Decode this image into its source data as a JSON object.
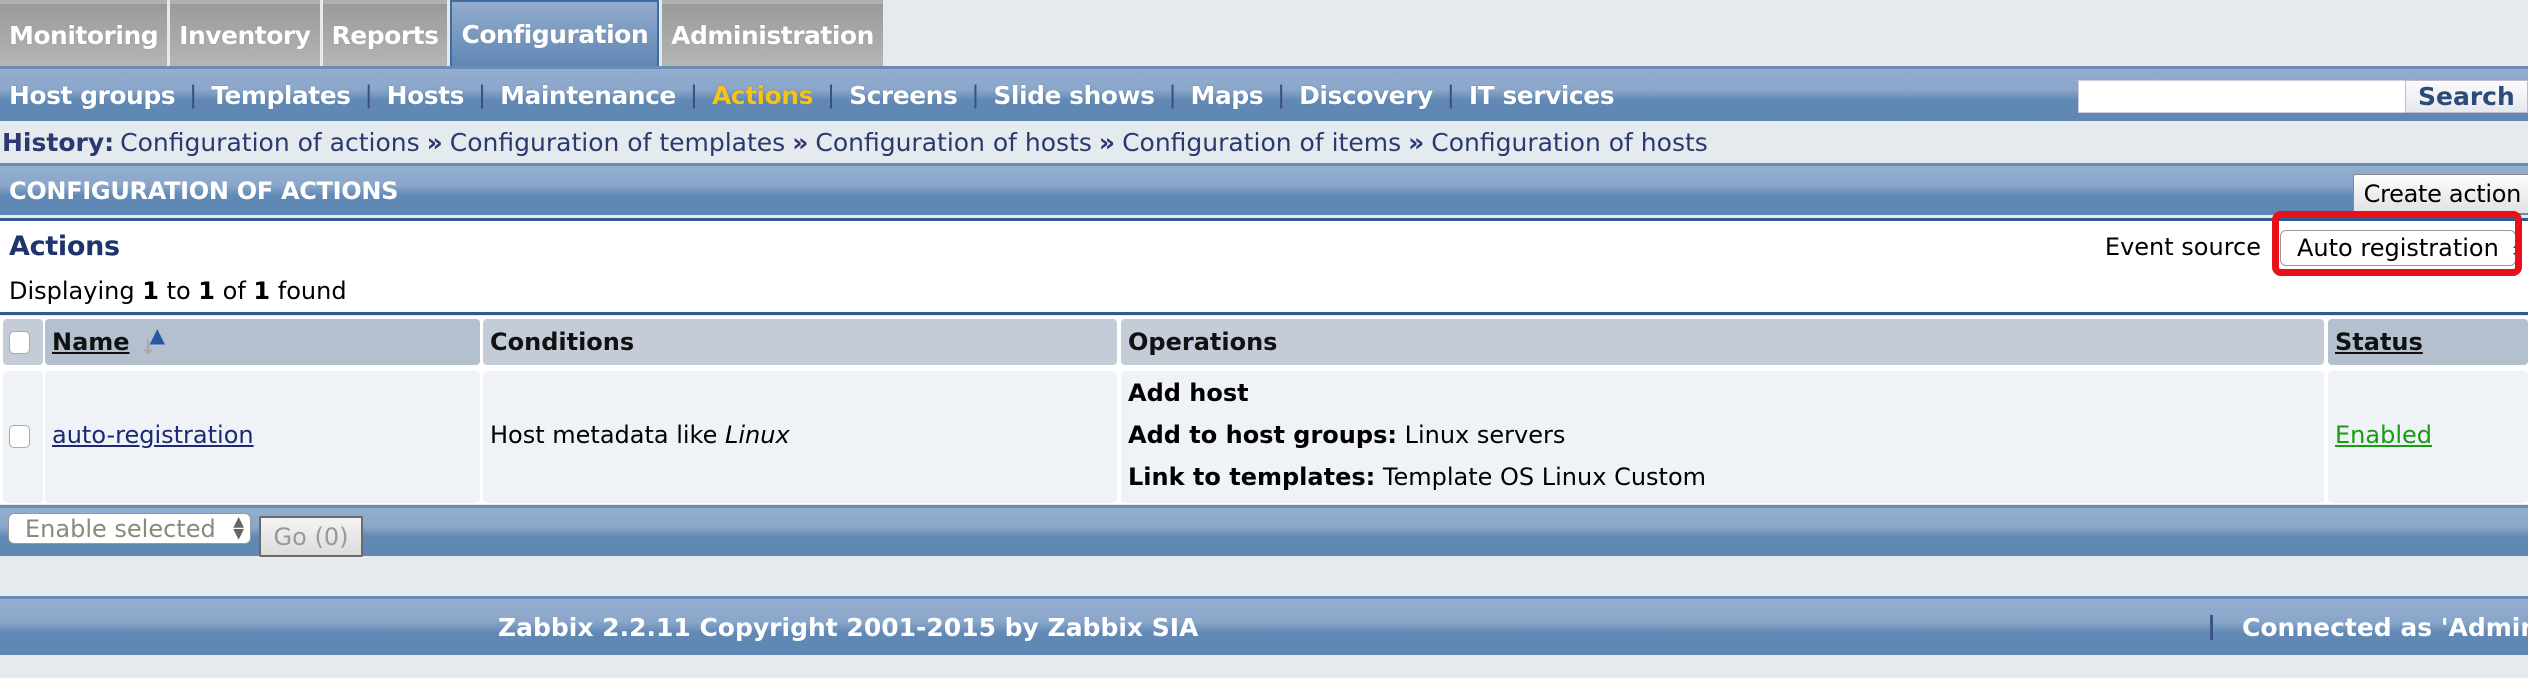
{
  "top_tabs": [
    {
      "label": "Monitoring",
      "active": false
    },
    {
      "label": "Inventory",
      "active": false
    },
    {
      "label": "Reports",
      "active": false
    },
    {
      "label": "Configuration",
      "active": true
    },
    {
      "label": "Administration",
      "active": false
    }
  ],
  "sub_nav": {
    "items": [
      {
        "label": "Host groups",
        "active": false
      },
      {
        "label": "Templates",
        "active": false
      },
      {
        "label": "Hosts",
        "active": false
      },
      {
        "label": "Maintenance",
        "active": false
      },
      {
        "label": "Actions",
        "active": true
      },
      {
        "label": "Screens",
        "active": false
      },
      {
        "label": "Slide shows",
        "active": false
      },
      {
        "label": "Maps",
        "active": false
      },
      {
        "label": "Discovery",
        "active": false
      },
      {
        "label": "IT services",
        "active": false
      }
    ],
    "separator": "|",
    "search_value": "",
    "search_button": "Search"
  },
  "history": {
    "label": "History:",
    "separator": "»",
    "links": [
      "Configuration of actions",
      "Configuration of templates",
      "Configuration of hosts",
      "Configuration of items",
      "Configuration of hosts"
    ]
  },
  "config_header": {
    "title": "CONFIGURATION OF ACTIONS",
    "create_button": "Create action"
  },
  "panel": {
    "title": "Actions",
    "displaying_prefix": "Displaying",
    "from": "1",
    "to_word": "to",
    "to": "1",
    "of_word": "of",
    "total": "1",
    "found_word": "found",
    "event_source_label": "Event source",
    "event_source_value": "Auto registration"
  },
  "table": {
    "columns": [
      "Name",
      "Conditions",
      "Operations",
      "Status"
    ],
    "rows": [
      {
        "name": "auto-registration",
        "condition_prefix": "Host metadata like",
        "condition_value": "Linux",
        "operations": [
          {
            "label": "Add host",
            "value": ""
          },
          {
            "label": "Add to host groups:",
            "value": "Linux servers"
          },
          {
            "label": "Link to templates:",
            "value": "Template OS Linux Custom"
          }
        ],
        "status": "Enabled"
      }
    ]
  },
  "mass_action": {
    "selected": "Enable selected",
    "go_button": "Go (0)"
  },
  "footer": {
    "copyright": "Zabbix 2.2.11 Copyright 2001-2015 by Zabbix SIA",
    "separator": "|",
    "connected": "Connected as 'Admin'"
  },
  "colors": {
    "active_subnav": "#f7c21a",
    "status_enabled": "#179e0e",
    "highlight": "#e8101a"
  }
}
